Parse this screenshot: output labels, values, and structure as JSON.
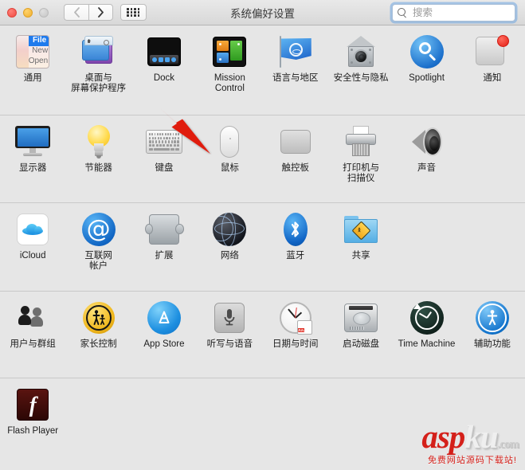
{
  "window": {
    "title": "系统偏好设置",
    "traffic_lights": [
      "close",
      "minimize",
      "zoom"
    ]
  },
  "toolbar": {
    "back_label": "‹",
    "forward_label": "›",
    "show_all_label": "show-all-grid"
  },
  "search": {
    "placeholder": "搜索",
    "value": "",
    "clear_label": "✕"
  },
  "rows": [
    {
      "id": "personal",
      "items": [
        {
          "name": "general",
          "label": "通用",
          "icon": "general-icon",
          "icon_text": {
            "m1": "File",
            "m2": "New",
            "m3": "Open"
          }
        },
        {
          "name": "desktop",
          "label": "桌面与\n屏幕保护程序",
          "icon": "desktop-screensaver-icon"
        },
        {
          "name": "dock",
          "label": "Dock",
          "icon": "dock-icon"
        },
        {
          "name": "mission-control",
          "label": "Mission\nControl",
          "icon": "mission-control-icon"
        },
        {
          "name": "language",
          "label": "语言与地区",
          "icon": "language-region-flag-icon"
        },
        {
          "name": "security",
          "label": "安全性与隐私",
          "icon": "security-privacy-icon"
        },
        {
          "name": "spotlight",
          "label": "Spotlight",
          "icon": "spotlight-icon"
        },
        {
          "name": "notifications",
          "label": "通知",
          "icon": "notifications-icon"
        }
      ]
    },
    {
      "id": "hardware",
      "items": [
        {
          "name": "displays",
          "label": "显示器",
          "icon": "display-icon"
        },
        {
          "name": "energy",
          "label": "节能器",
          "icon": "energy-saver-bulb-icon"
        },
        {
          "name": "keyboard",
          "label": "键盘",
          "icon": "keyboard-icon"
        },
        {
          "name": "mouse",
          "label": "鼠标",
          "icon": "mouse-icon"
        },
        {
          "name": "trackpad",
          "label": "触控板",
          "icon": "trackpad-icon"
        },
        {
          "name": "printers",
          "label": "打印机与\n扫描仪",
          "icon": "printer-scanner-icon"
        },
        {
          "name": "sound",
          "label": "声音",
          "icon": "sound-speaker-icon"
        }
      ]
    },
    {
      "id": "internet",
      "items": [
        {
          "name": "icloud",
          "label": "iCloud",
          "icon": "icloud-icon"
        },
        {
          "name": "accounts",
          "label": "互联网\n帐户",
          "icon": "internet-accounts-at-icon"
        },
        {
          "name": "extensions",
          "label": "扩展",
          "icon": "extensions-puzzle-icon"
        },
        {
          "name": "network",
          "label": "网络",
          "icon": "network-globe-icon"
        },
        {
          "name": "bluetooth",
          "label": "蓝牙",
          "icon": "bluetooth-icon"
        },
        {
          "name": "sharing",
          "label": "共享",
          "icon": "sharing-folder-icon"
        }
      ]
    },
    {
      "id": "system",
      "items": [
        {
          "name": "users",
          "label": "用户与群组",
          "icon": "users-groups-icon"
        },
        {
          "name": "parental",
          "label": "家长控制",
          "icon": "parental-controls-icon"
        },
        {
          "name": "app-store",
          "label": "App Store",
          "icon": "app-store-icon"
        },
        {
          "name": "dictation",
          "label": "听写与语音",
          "icon": "dictation-speech-mic-icon"
        },
        {
          "name": "date-time",
          "label": "日期与时间",
          "icon": "date-time-clock-icon",
          "icon_text": {
            "month": "JUL",
            "day": "18"
          }
        },
        {
          "name": "startup-disk",
          "label": "启动磁盘",
          "icon": "startup-disk-icon"
        },
        {
          "name": "time-machine",
          "label": "Time Machine",
          "icon": "time-machine-icon"
        },
        {
          "name": "accessibility",
          "label": "辅助功能",
          "icon": "accessibility-icon"
        }
      ]
    },
    {
      "id": "other",
      "items": [
        {
          "name": "flash-player",
          "label": "Flash Player",
          "icon": "flash-player-icon",
          "icon_text": {
            "glyph": "f"
          }
        }
      ]
    }
  ],
  "annotation": {
    "arrow_color": "#e01b10",
    "points_to": "dock"
  },
  "watermark": {
    "part1": "asp",
    "part2": "ku",
    "part3": ".com",
    "subtitle": "免费网站源码下载站!",
    "color_primary": "#d4201a"
  }
}
